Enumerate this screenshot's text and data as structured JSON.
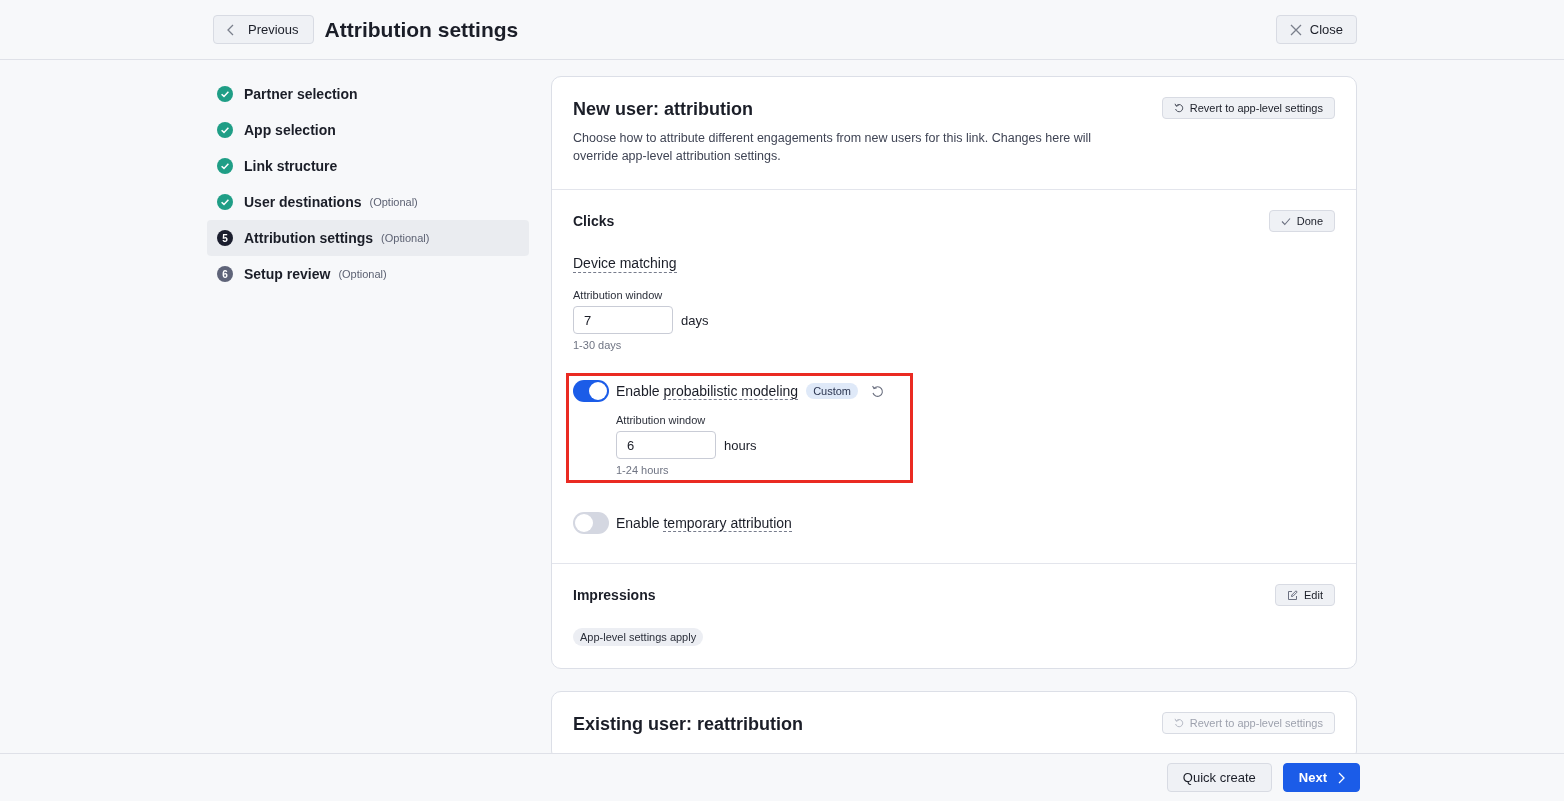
{
  "header": {
    "back_button": "Previous",
    "title": "Attribution settings",
    "close_button": "Close"
  },
  "steps": [
    {
      "label": "Partner selection",
      "done": true,
      "selected": false
    },
    {
      "label": "App selection",
      "done": true,
      "selected": false
    },
    {
      "label": "Link structure",
      "done": true,
      "selected": false
    },
    {
      "label": "User destinations",
      "optional": "(Optional)",
      "done": true,
      "selected": false
    },
    {
      "number": "5",
      "label": "Attribution settings",
      "optional": "(Optional)",
      "done": false,
      "selected": true
    },
    {
      "number": "6",
      "label": "Setup review",
      "optional": "(Optional)",
      "done": false,
      "selected": false
    }
  ],
  "cards": [
    {
      "title": "New user: attribution",
      "description": "Choose how to attribute different engagements from new users for this link. Changes here will override app-level attribution settings.",
      "revert_button": {
        "label": "Revert to app-level settings",
        "disabled": false
      },
      "sections": [
        {
          "kind": "clicks",
          "title": "Clicks",
          "action": "Done",
          "subheading": "Device matching",
          "field": {
            "label": "Attribution window",
            "value": "7",
            "unit": "days",
            "hint": "1-30 days"
          },
          "toggles": [
            {
              "prefix": "Enable",
              "term": "probabilistic modeling",
              "on": true,
              "highlighted": true,
              "badge": "Custom",
              "field": {
                "label": "Attribution window",
                "value": "6",
                "unit": "hours",
                "hint": "1-24 hours"
              }
            },
            {
              "prefix": "Enable",
              "term": "temporary attribution",
              "on": false
            }
          ]
        },
        {
          "kind": "impressions",
          "title": "Impressions",
          "action": "Edit",
          "tag": "App-level settings apply"
        }
      ]
    },
    {
      "title": "Existing user: reattribution",
      "revert_button": {
        "label": "Revert to app-level settings",
        "disabled": true
      }
    }
  ],
  "footer": {
    "secondary_button": "Quick create",
    "primary_button": "Next"
  }
}
